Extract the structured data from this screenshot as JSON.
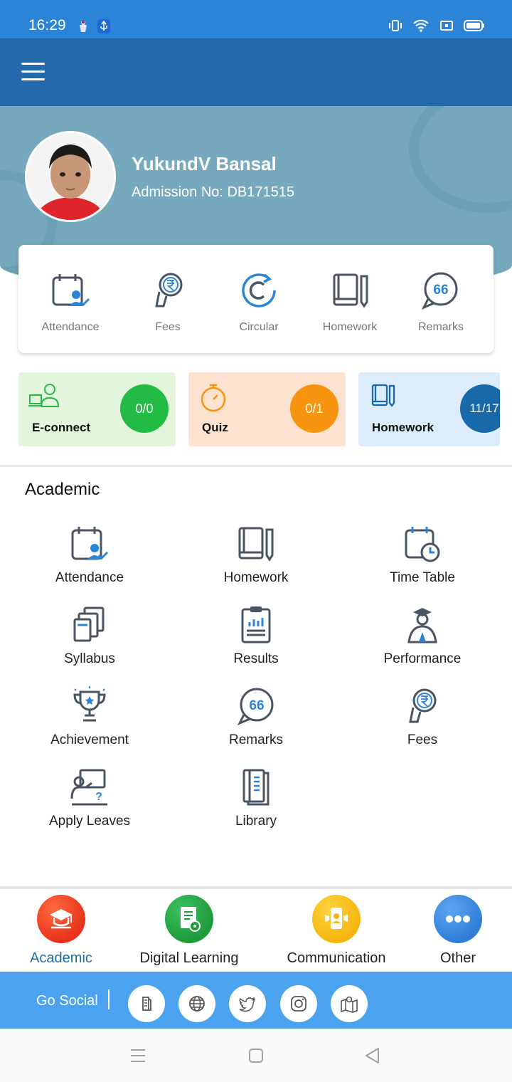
{
  "status_bar": {
    "time": "16:29"
  },
  "profile": {
    "name": "YukundV Bansal",
    "admission": "Admission No: DB171515"
  },
  "quick_actions": [
    {
      "label": "Attendance",
      "icon": "calendar-user-icon"
    },
    {
      "label": "Fees",
      "icon": "rupee-hand-icon"
    },
    {
      "label": "Circular",
      "icon": "circular-icon"
    },
    {
      "label": "Homework",
      "icon": "book-pencil-icon"
    },
    {
      "label": "Remarks",
      "icon": "quote-bubble-icon"
    }
  ],
  "summary_cards": [
    {
      "title": "E-connect",
      "count": "0/0",
      "bg": "#e3f5dc",
      "accent": "#22bb44",
      "icon": "people-laptop-icon"
    },
    {
      "title": "Quiz",
      "count": "0/1",
      "bg": "#fde3cf",
      "accent": "#f7940f",
      "icon": "stopwatch-icon"
    },
    {
      "title": "Homework",
      "count": "11/17",
      "bg": "#dcecfb",
      "accent": "#1769aa",
      "icon": "book-pencil-icon"
    }
  ],
  "academic": {
    "title": "Academic",
    "items": [
      {
        "label": "Attendance",
        "icon": "calendar-user-icon"
      },
      {
        "label": "Homework",
        "icon": "book-pencil-icon"
      },
      {
        "label": "Time Table",
        "icon": "calendar-clock-icon"
      },
      {
        "label": "Syllabus",
        "icon": "documents-icon"
      },
      {
        "label": "Results",
        "icon": "clipboard-chart-icon"
      },
      {
        "label": "Performance",
        "icon": "graduate-icon"
      },
      {
        "label": "Achievement",
        "icon": "trophy-icon"
      },
      {
        "label": "Remarks",
        "icon": "quote-bubble-icon"
      },
      {
        "label": "Fees",
        "icon": "rupee-hand-icon"
      },
      {
        "label": "Apply Leaves",
        "icon": "teacher-board-icon"
      },
      {
        "label": "Library",
        "icon": "library-book-icon"
      }
    ]
  },
  "bottom_nav": [
    {
      "label": "Academic",
      "icon": "graduation-cap-icon",
      "color": "#e8331c",
      "active": true
    },
    {
      "label": "Digital Learning",
      "icon": "digital-book-icon",
      "color": "#1f9b3a",
      "active": false
    },
    {
      "label": "Communication",
      "icon": "megaphone-phone-icon",
      "color": "#f5b50f",
      "active": false
    },
    {
      "label": "Other",
      "icon": "more-dots-icon",
      "color": "#2f7fd8",
      "active": false
    }
  ],
  "social": {
    "label": "Go Social",
    "links": [
      "blog-icon",
      "globe-icon",
      "twitter-icon",
      "instagram-icon",
      "map-icon"
    ]
  },
  "colors": {
    "status_bar": "#2b84d6",
    "app_bar": "#2569ad",
    "profile_bg": "#76a9bd",
    "social_bar": "#4ba3f0",
    "active_nav": "#1b6fa8"
  }
}
